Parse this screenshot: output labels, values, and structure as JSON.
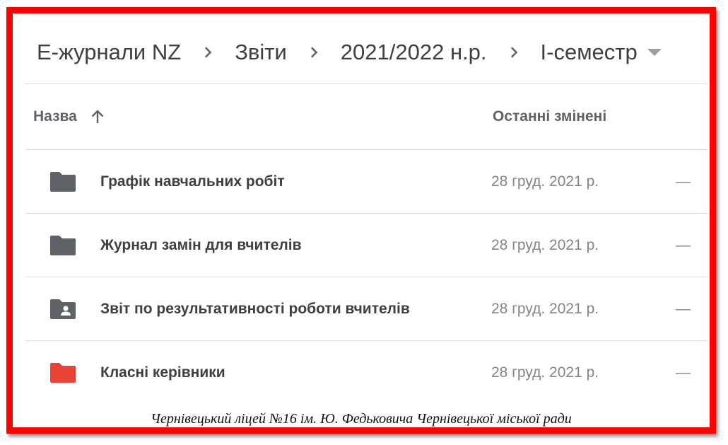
{
  "breadcrumb": {
    "items": [
      "Е-журнали NZ",
      "Звіти",
      "2021/2022 н.р.",
      "І-семестр"
    ],
    "separator_icon": "chevron-right-icon",
    "dropdown_icon": "caret-down-icon"
  },
  "header": {
    "name_label": "Назва",
    "sort_icon": "arrow-up-icon",
    "modified_label": "Останні змінені"
  },
  "rows": [
    {
      "icon": "folder-icon",
      "icon_color": "#5f6368",
      "name": "Графік навчальних робіт",
      "modified": "28 груд. 2021 р.",
      "size": "—"
    },
    {
      "icon": "folder-icon",
      "icon_color": "#5f6368",
      "name": "Журнал замін для вчителів",
      "modified": "28 груд. 2021 р.",
      "size": "—"
    },
    {
      "icon": "shared-folder-icon",
      "icon_color": "#5f6368",
      "name": "Звіт по результативності роботи вчителів",
      "modified": "28 груд. 2021 р.",
      "size": "—"
    },
    {
      "icon": "folder-icon",
      "icon_color": "#ea4335",
      "name": "Класні керівники",
      "modified": "28 груд. 2021 р.",
      "size": "—"
    }
  ],
  "footer": {
    "caption": "Чернівецький ліцей №16 ім. Ю. Федьковича Чернівецької міської ради"
  },
  "colors": {
    "frame_border": "#ff0000",
    "text_primary": "#3c4043",
    "text_secondary": "#5f6368",
    "divider": "#dadce0"
  }
}
